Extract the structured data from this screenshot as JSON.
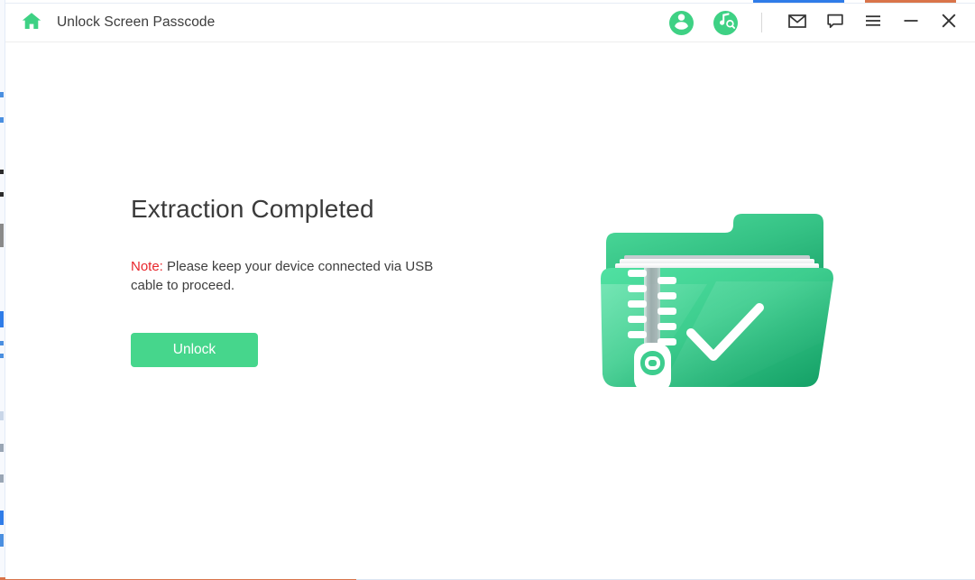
{
  "window": {
    "title": "Unlock Screen Passcode",
    "home_icon": "home-icon"
  },
  "titlebar": {
    "account_icon": "account-circle-icon",
    "music_search_icon": "music-search-circle-icon",
    "mail_icon": "mail-icon",
    "feedback_icon": "chat-bubble-icon",
    "menu_icon": "hamburger-menu-icon",
    "minimize_icon": "minimize-icon",
    "close_icon": "close-icon"
  },
  "main": {
    "headline": "Extraction Completed",
    "note_label": "Note:",
    "note_text": " Please keep your device connected via USB cable to proceed.",
    "unlock_label": "Unlock",
    "illustration_icon": "zipped-folder-check-icon"
  },
  "colors": {
    "accent_green": "#46d68c",
    "icon_green": "#3ed184",
    "note_red": "#e8262c",
    "text_dark": "#3b3b3b",
    "titlebar_icon": "#333333",
    "bg_bar_blue": "#2f7ce8",
    "bg_bar_orange": "#d9744a"
  }
}
